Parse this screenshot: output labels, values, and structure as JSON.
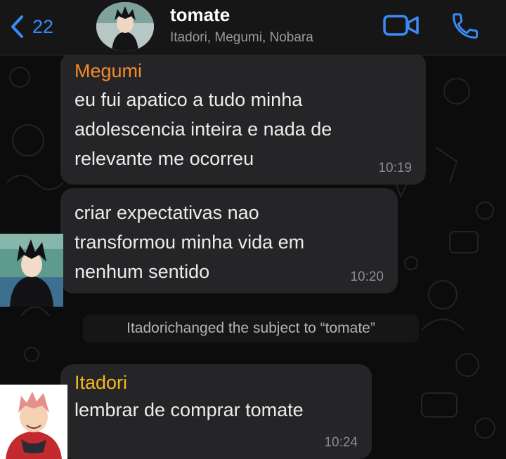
{
  "header": {
    "back_count": "22",
    "title": "tomate",
    "subtitle": "Itadori, Megumi, Nobara",
    "accent_color": "#3a8bf7",
    "icons": [
      "chevron-left-icon",
      "video-camera-icon",
      "phone-icon"
    ]
  },
  "messages": [
    {
      "sender": "Megumi",
      "sender_color": "#f58a26",
      "lines": [
        "eu fui apatico a tudo minha",
        "adolescencia inteira e nada de",
        "relevante me ocorreu"
      ],
      "time": "10:19"
    },
    {
      "lines": [
        "criar expectativas nao",
        "transformou minha vida em",
        "nenhum sentido"
      ],
      "time": "10:20"
    },
    {
      "sender": "Itadori",
      "sender_color": "#f5b81c",
      "lines": [
        "lembrar de comprar tomate"
      ],
      "time": "10:24"
    }
  ],
  "system_message": "Itadorichanged the subject to “tomate”"
}
